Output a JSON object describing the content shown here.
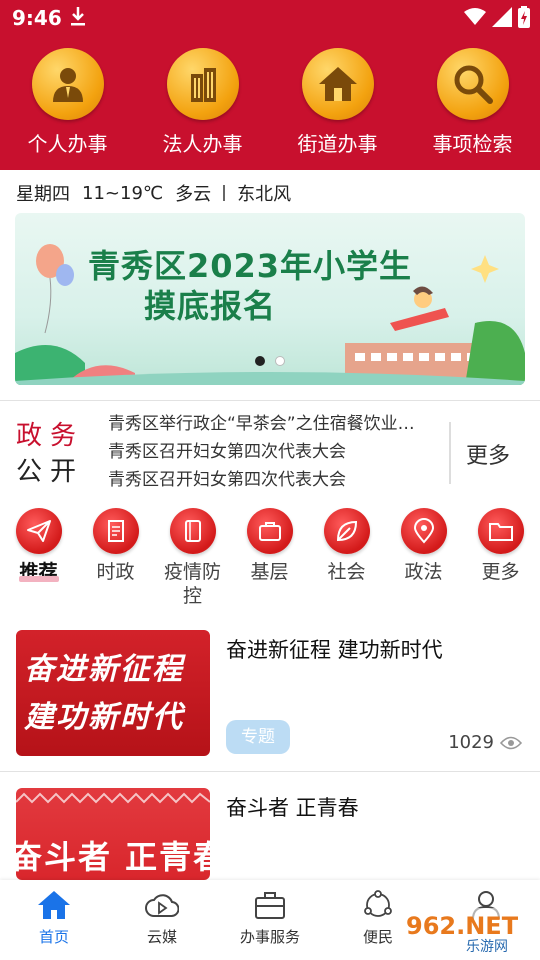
{
  "status": {
    "time": "9:46"
  },
  "quick_services": [
    {
      "label": "个人办事",
      "icon": "person-icon"
    },
    {
      "label": "法人办事",
      "icon": "building-icon"
    },
    {
      "label": "街道办事",
      "icon": "house-icon"
    },
    {
      "label": "事项检索",
      "icon": "search-icon"
    }
  ],
  "weather": {
    "weekday": "星期四",
    "temp": "11~19℃",
    "condition": "多云",
    "wind": "东北风"
  },
  "banner": {
    "line1": "青秀区2023年小学生",
    "line2": "摸底报名"
  },
  "gov_news": {
    "title_line1": "政务",
    "title_line2": "公开",
    "items": [
      "青秀区举行政企“早茶会”之住宿餐饮业…",
      "青秀区召开妇女第四次代表大会",
      "青秀区召开妇女第四次代表大会"
    ],
    "more_label": "更多"
  },
  "categories": [
    {
      "label": "推荐",
      "icon": "paper-plane-icon",
      "active": true
    },
    {
      "label": "时政",
      "icon": "scroll-icon",
      "active": false
    },
    {
      "label": "疫情防控",
      "icon": "book-icon",
      "active": false
    },
    {
      "label": "基层",
      "icon": "briefcase-icon",
      "active": false
    },
    {
      "label": "社会",
      "icon": "leaf-icon",
      "active": false
    },
    {
      "label": "政法",
      "icon": "location-pin-icon",
      "active": false
    },
    {
      "label": "更多",
      "icon": "folder-icon",
      "active": false
    }
  ],
  "articles": [
    {
      "title": "奋进新征程 建功新时代",
      "image_text_1": "奋进新征程",
      "image_text_2": "建功新时代",
      "tag": "专题",
      "views": "1029"
    },
    {
      "title": "奋斗者 正青春",
      "image_text_1": "奋斗者 正青春",
      "tag": "",
      "views": ""
    }
  ],
  "bottom_nav": [
    {
      "label": "首页",
      "icon": "home-icon",
      "active": true
    },
    {
      "label": "云媒",
      "icon": "cloud-play-icon",
      "active": false
    },
    {
      "label": "办事服务",
      "icon": "briefcase-icon",
      "active": false
    },
    {
      "label": "便民",
      "icon": "network-icon",
      "active": false
    },
    {
      "label": "",
      "icon": "user-icon",
      "active": false
    }
  ],
  "watermark": {
    "text": "962.NET",
    "sub": "乐游网"
  },
  "colors": {
    "brand_red": "#c8102e",
    "accent_blue": "#1a73e8",
    "gold": "#f3a20f"
  }
}
